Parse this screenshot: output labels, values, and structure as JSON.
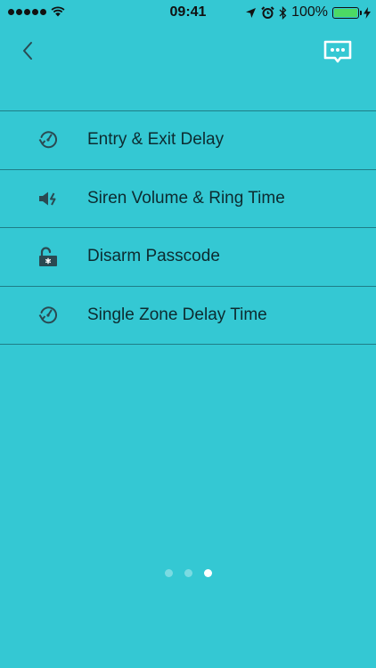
{
  "status_bar": {
    "time": "09:41",
    "battery": "100%",
    "battery_level": 1.0
  },
  "nav": {
    "back_icon": "chevron-left-icon",
    "chat_icon": "chat-bubble-icon"
  },
  "menu": {
    "items": [
      {
        "label": "Entry & Exit Delay",
        "icon": "timer-icon"
      },
      {
        "label": "Siren Volume & Ring Time",
        "icon": "speaker-icon"
      },
      {
        "label": "Disarm Passcode",
        "icon": "unlock-icon"
      },
      {
        "label": "Single Zone Delay Time",
        "icon": "timer-icon"
      }
    ]
  },
  "pagination": {
    "count": 3,
    "active_index": 2
  },
  "colors": {
    "background": "#34c8d3",
    "divider": "#1f7d87",
    "icon": "#2a4a52"
  }
}
